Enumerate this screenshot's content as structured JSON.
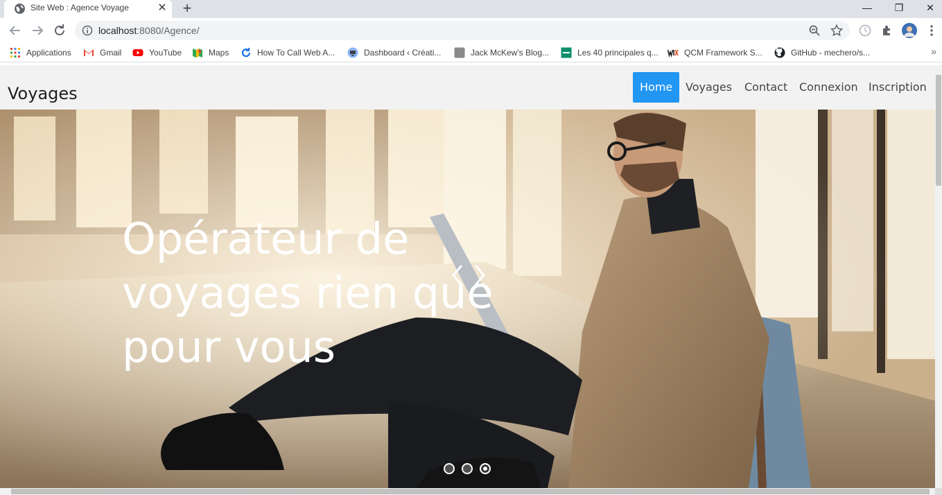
{
  "browser": {
    "tab_title": "Site Web : Agence Voyage",
    "tab_close": "✕",
    "new_tab": "+",
    "window": {
      "minimize": "—",
      "restore": "❐",
      "close": "✕"
    },
    "url_host": "localhost",
    "url_rest": ":8080/Agence/",
    "bookmarks": [
      {
        "label": "Applications",
        "icon": "apps-grid-icon"
      },
      {
        "label": "Gmail",
        "icon": "gmail-icon"
      },
      {
        "label": "YouTube",
        "icon": "youtube-icon"
      },
      {
        "label": "Maps",
        "icon": "maps-icon"
      },
      {
        "label": "How To Call Web A...",
        "icon": "refresh-blue-icon"
      },
      {
        "label": "Dashboard ‹ Créati...",
        "icon": "monitor-icon"
      },
      {
        "label": "Jack McKew's Blog...",
        "icon": "gray-square-icon"
      },
      {
        "label": "Les 40 principales q...",
        "icon": "green-square-icon"
      },
      {
        "label": "QCM Framework S...",
        "icon": "wix-icon"
      },
      {
        "label": "GitHub - mechero/s...",
        "icon": "github-icon"
      }
    ],
    "bookmarks_more": "»"
  },
  "site": {
    "brand": "Voyages",
    "nav": [
      "Home",
      "Voyages",
      "Contact",
      "Connexion",
      "Inscription"
    ],
    "active_nav": "Home",
    "hero": {
      "title_lines": [
        "Opérateur de",
        "voyages rien que",
        "pour vous"
      ],
      "slides": 3,
      "active_slide": 3
    }
  },
  "colors": {
    "accent": "#2196f3",
    "tabstrip": "#dee1e6",
    "navbar": "#f2f2f2"
  }
}
